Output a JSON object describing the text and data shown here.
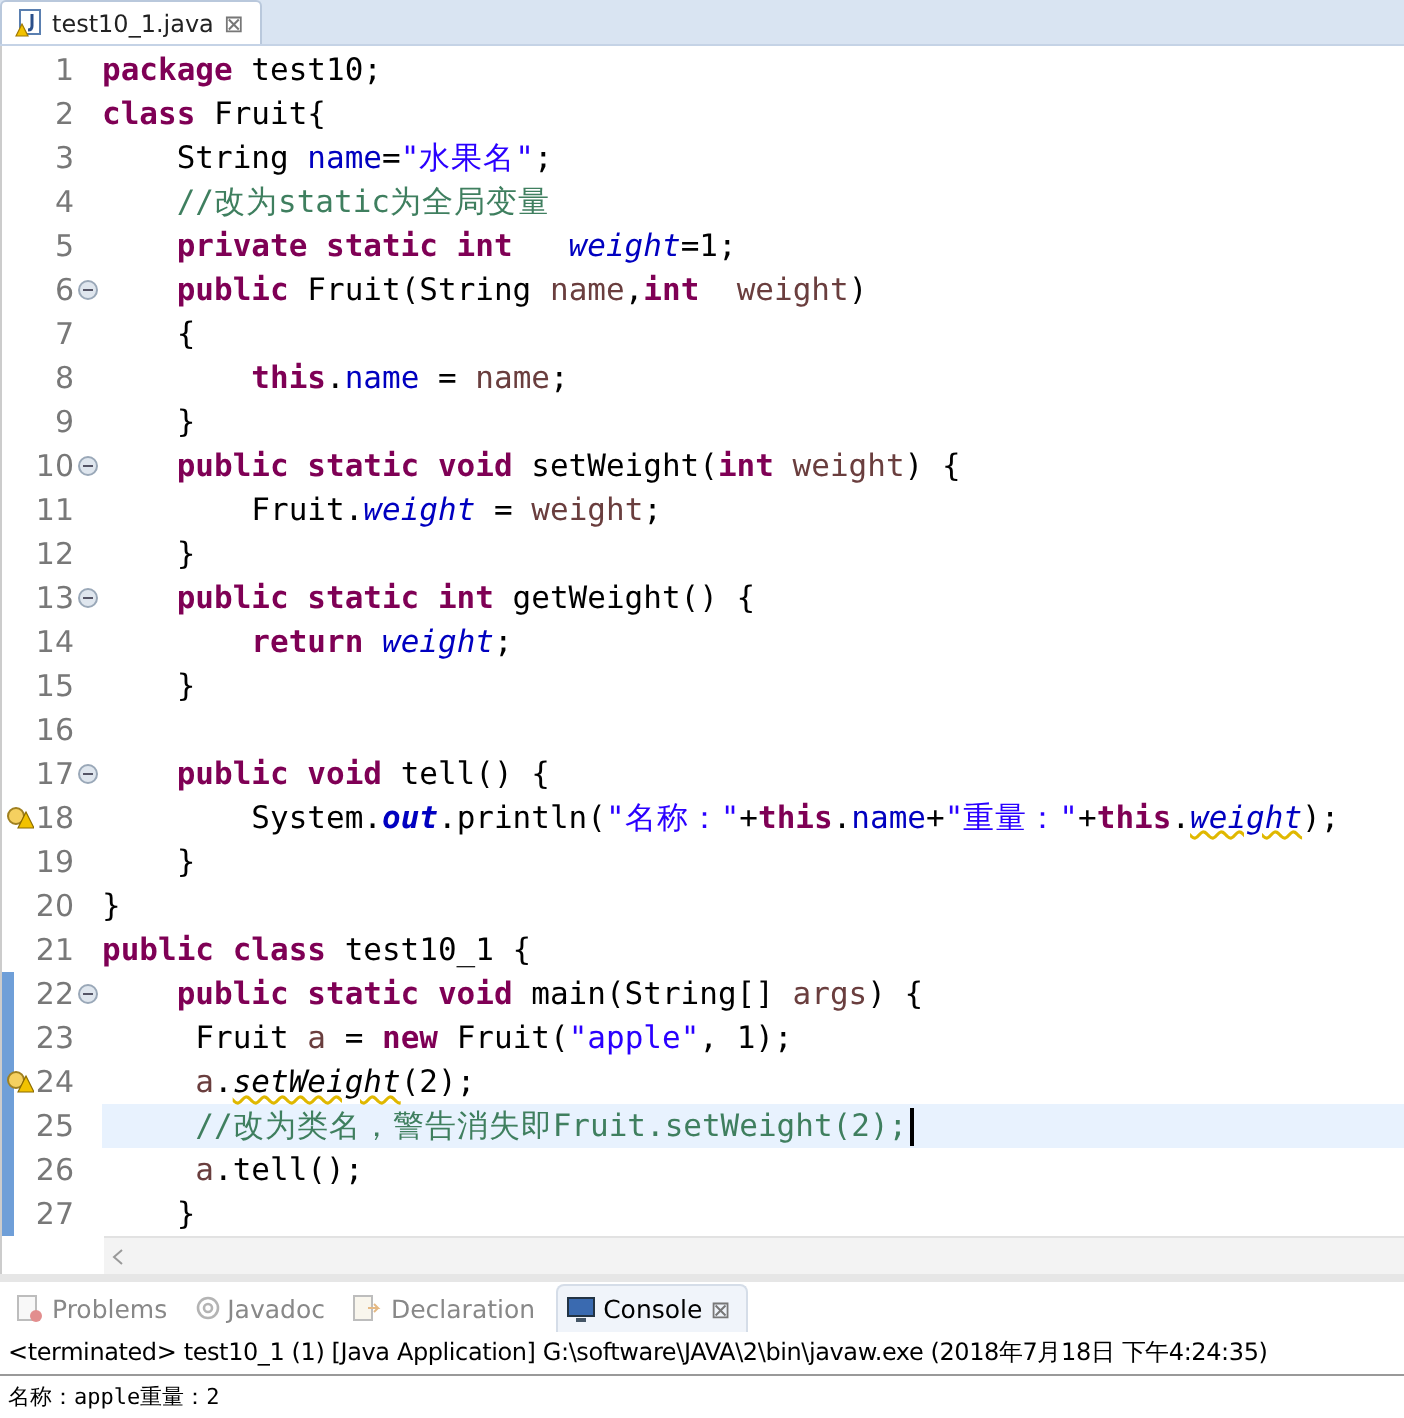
{
  "editor_tab": {
    "label": "test10_1.java",
    "close": "⊠",
    "selected": true
  },
  "lines": [
    {
      "number": "1",
      "tokens": [
        {
          "kind": "keyword",
          "text": "package"
        },
        {
          "kind": "plain",
          "text": " test10;"
        }
      ]
    },
    {
      "number": "2",
      "tokens": [
        {
          "kind": "keyword",
          "text": "class"
        },
        {
          "kind": "plain",
          "text": " Fruit{"
        }
      ]
    },
    {
      "number": "3",
      "tokens": [
        {
          "kind": "plain",
          "text": "    String "
        },
        {
          "kind": "field",
          "text": "name"
        },
        {
          "kind": "plain",
          "text": "="
        },
        {
          "kind": "string",
          "text": "\"水果名\""
        },
        {
          "kind": "plain",
          "text": ";"
        }
      ]
    },
    {
      "number": "4",
      "tokens": [
        {
          "kind": "comment",
          "text": "    //改为static为全局变量"
        }
      ]
    },
    {
      "number": "5",
      "tokens": [
        {
          "kind": "keyword",
          "text": "    private static int"
        },
        {
          "kind": "static_field",
          "text": "   weight"
        },
        {
          "kind": "plain",
          "text": "=1;"
        }
      ]
    },
    {
      "number": "6",
      "fold": true,
      "tokens": [
        {
          "kind": "keyword",
          "text": "    public"
        },
        {
          "kind": "plain",
          "text": " Fruit(String "
        },
        {
          "kind": "local",
          "text": "name"
        },
        {
          "kind": "plain",
          "text": ","
        },
        {
          "kind": "keyword",
          "text": "int"
        },
        {
          "kind": "local",
          "text": "  weight"
        },
        {
          "kind": "plain",
          "text": ")"
        }
      ]
    },
    {
      "number": "7",
      "tokens": [
        {
          "kind": "plain",
          "text": "    {"
        }
      ]
    },
    {
      "number": "8",
      "tokens": [
        {
          "kind": "keyword",
          "text": "        this"
        },
        {
          "kind": "plain",
          "text": "."
        },
        {
          "kind": "field",
          "text": "name"
        },
        {
          "kind": "plain",
          "text": " = "
        },
        {
          "kind": "local",
          "text": "name"
        },
        {
          "kind": "plain",
          "text": ";"
        }
      ]
    },
    {
      "number": "9",
      "tokens": [
        {
          "kind": "plain",
          "text": "    }"
        }
      ]
    },
    {
      "number": "10",
      "fold": true,
      "tokens": [
        {
          "kind": "keyword",
          "text": "    public static void"
        },
        {
          "kind": "plain",
          "text": " setWeight("
        },
        {
          "kind": "keyword",
          "text": "int"
        },
        {
          "kind": "local",
          "text": " weight"
        },
        {
          "kind": "plain",
          "text": ") {"
        }
      ]
    },
    {
      "number": "11",
      "tokens": [
        {
          "kind": "plain",
          "text": "        Fruit."
        },
        {
          "kind": "static_field",
          "text": "weight"
        },
        {
          "kind": "plain",
          "text": " = "
        },
        {
          "kind": "local",
          "text": "weight"
        },
        {
          "kind": "plain",
          "text": ";"
        }
      ]
    },
    {
      "number": "12",
      "tokens": [
        {
          "kind": "plain",
          "text": "    }"
        }
      ]
    },
    {
      "number": "13",
      "fold": true,
      "tokens": [
        {
          "kind": "keyword",
          "text": "    public static int"
        },
        {
          "kind": "plain",
          "text": " getWeight() {"
        }
      ]
    },
    {
      "number": "14",
      "tokens": [
        {
          "kind": "keyword",
          "text": "        return"
        },
        {
          "kind": "static_field",
          "text": " weight"
        },
        {
          "kind": "plain",
          "text": ";"
        }
      ]
    },
    {
      "number": "15",
      "tokens": [
        {
          "kind": "plain",
          "text": "    }"
        }
      ]
    },
    {
      "number": "16"
    },
    {
      "number": "17",
      "fold": true,
      "tokens": [
        {
          "kind": "keyword",
          "text": "    public void"
        },
        {
          "kind": "plain",
          "text": " tell() {"
        }
      ]
    },
    {
      "number": "18",
      "warning": true,
      "tokens": [
        {
          "kind": "plain",
          "text": "        System."
        },
        {
          "kind": "static_final",
          "text": "out"
        },
        {
          "kind": "plain",
          "text": ".println("
        },
        {
          "kind": "string",
          "text": "\"名称：\""
        },
        {
          "kind": "plain",
          "text": "+"
        },
        {
          "kind": "keyword",
          "text": "this"
        },
        {
          "kind": "plain",
          "text": "."
        },
        {
          "kind": "field",
          "text": "name"
        },
        {
          "kind": "plain",
          "text": "+"
        },
        {
          "kind": "string",
          "text": "\"重量：\""
        },
        {
          "kind": "plain",
          "text": "+"
        },
        {
          "kind": "keyword",
          "text": "this"
        },
        {
          "kind": "plain",
          "text": "."
        },
        {
          "kind": "static_field_warned",
          "text": "weight"
        },
        {
          "kind": "plain",
          "text": ");"
        }
      ]
    },
    {
      "number": "19",
      "tokens": [
        {
          "kind": "plain",
          "text": "    }"
        }
      ]
    },
    {
      "number": "20",
      "tokens": [
        {
          "kind": "plain",
          "text": "}"
        }
      ]
    },
    {
      "number": "21",
      "tokens": [
        {
          "kind": "keyword",
          "text": "public class"
        },
        {
          "kind": "plain",
          "text": " test10_1 {"
        }
      ]
    },
    {
      "number": "22",
      "fold": true,
      "changed": true,
      "tokens": [
        {
          "kind": "keyword",
          "text": "    public static void"
        },
        {
          "kind": "plain",
          "text": " main(String[] "
        },
        {
          "kind": "local",
          "text": "args"
        },
        {
          "kind": "plain",
          "text": ") {"
        }
      ]
    },
    {
      "number": "23",
      "changed": true,
      "tokens": [
        {
          "kind": "plain",
          "text": "     Fruit "
        },
        {
          "kind": "local",
          "text": "a"
        },
        {
          "kind": "plain",
          "text": " = "
        },
        {
          "kind": "keyword",
          "text": "new"
        },
        {
          "kind": "plain",
          "text": " Fruit("
        },
        {
          "kind": "string",
          "text": "\"apple\""
        },
        {
          "kind": "plain",
          "text": ", 1);"
        }
      ]
    },
    {
      "number": "24",
      "changed": true,
      "warning": true,
      "tokens": [
        {
          "kind": "local",
          "text": "     a"
        },
        {
          "kind": "plain",
          "text": "."
        },
        {
          "kind": "static_method_warned",
          "text": "setWeight"
        },
        {
          "kind": "plain",
          "text": "(2);"
        }
      ]
    },
    {
      "number": "25",
      "changed": true,
      "current": true,
      "tokens": [
        {
          "kind": "comment",
          "text": "     //改为类名，警告消失即Fruit.setWeight(2);"
        }
      ]
    },
    {
      "number": "26",
      "changed": true,
      "tokens": [
        {
          "kind": "local",
          "text": "     a"
        },
        {
          "kind": "plain",
          "text": ".tell();"
        }
      ]
    },
    {
      "number": "27",
      "changed": true,
      "tokens": [
        {
          "kind": "plain",
          "text": "    }"
        }
      ]
    }
  ],
  "panel_tabs": [
    {
      "label": "Problems",
      "kind": "problems",
      "selected": false
    },
    {
      "label": "Javadoc",
      "kind": "javadoc",
      "selected": false
    },
    {
      "label": "Declaration",
      "kind": "declaration",
      "selected": false
    },
    {
      "label": "Console",
      "kind": "console",
      "selected": true,
      "close": "⊠"
    }
  ],
  "console": {
    "header": "<terminated> test10_1 (1) [Java Application] G:\\software\\JAVA\\2\\bin\\javaw.exe (2018年7月18日 下午4:24:35)",
    "output": "名称：apple重量：2"
  }
}
